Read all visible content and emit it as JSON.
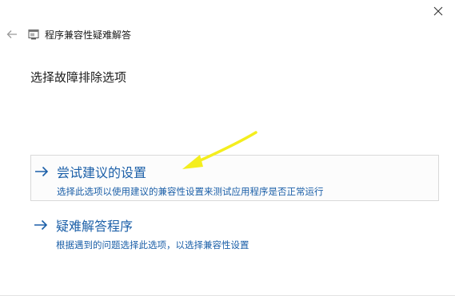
{
  "window": {
    "title": "程序兼容性疑难解答"
  },
  "icons": {
    "close": "close-icon",
    "back": "back-arrow-icon",
    "app": "compatibility-troubleshooter-icon",
    "option_arrow": "right-arrow-icon",
    "annotation": "yellow-pointer-arrow"
  },
  "page": {
    "title": "选择故障排除选项"
  },
  "options": [
    {
      "title": "尝试建议的设置",
      "description": "选择此选项以使用建议的兼容性设置来测试应用程序是否正常运行"
    },
    {
      "title": "疑难解答程序",
      "description": "根据遇到的问题选择此选项，以选择兼容性设置"
    }
  ],
  "colors": {
    "link_blue": "#1b5fa8",
    "annotation_yellow": "#f4ee1e"
  }
}
